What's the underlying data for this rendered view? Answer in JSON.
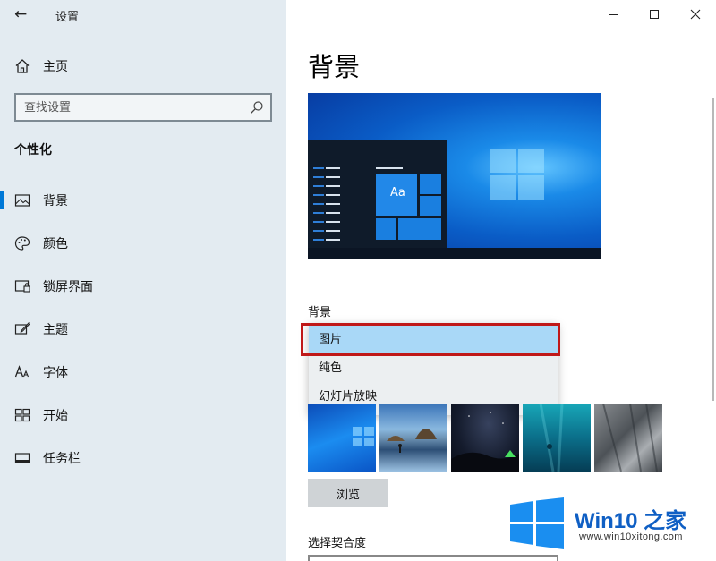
{
  "window": {
    "title": "设置"
  },
  "sidebar": {
    "home_label": "主页",
    "search_placeholder": "查找设置",
    "section_title": "个性化",
    "items": [
      {
        "label": "背景",
        "icon": "picture-icon",
        "selected": true
      },
      {
        "label": "颜色",
        "icon": "palette-icon",
        "selected": false
      },
      {
        "label": "锁屏界面",
        "icon": "lock-screen-icon",
        "selected": false
      },
      {
        "label": "主题",
        "icon": "theme-brush-icon",
        "selected": false
      },
      {
        "label": "字体",
        "icon": "font-icon",
        "selected": false
      },
      {
        "label": "开始",
        "icon": "start-grid-icon",
        "selected": false
      },
      {
        "label": "任务栏",
        "icon": "taskbar-icon",
        "selected": false
      }
    ]
  },
  "main": {
    "page_title": "背景",
    "preview_text": "Aa",
    "background_label": "背景",
    "dropdown_options": [
      {
        "label": "图片",
        "selected": true
      },
      {
        "label": "纯色",
        "selected": false
      },
      {
        "label": "幻灯片放映",
        "selected": false
      }
    ],
    "browse_label": "浏览",
    "fit_label": "选择契合度"
  },
  "watermark": {
    "brand_prefix": "Win10 ",
    "brand_suffix": "之家",
    "url": "www.win10xitong.com"
  },
  "colors": {
    "accent": "#0078d7",
    "sidebar_bg": "#e3ebf1",
    "selected_option_bg": "#a9d8f7",
    "highlight_border": "#c01818",
    "brand_blue": "#0f5fc4"
  }
}
